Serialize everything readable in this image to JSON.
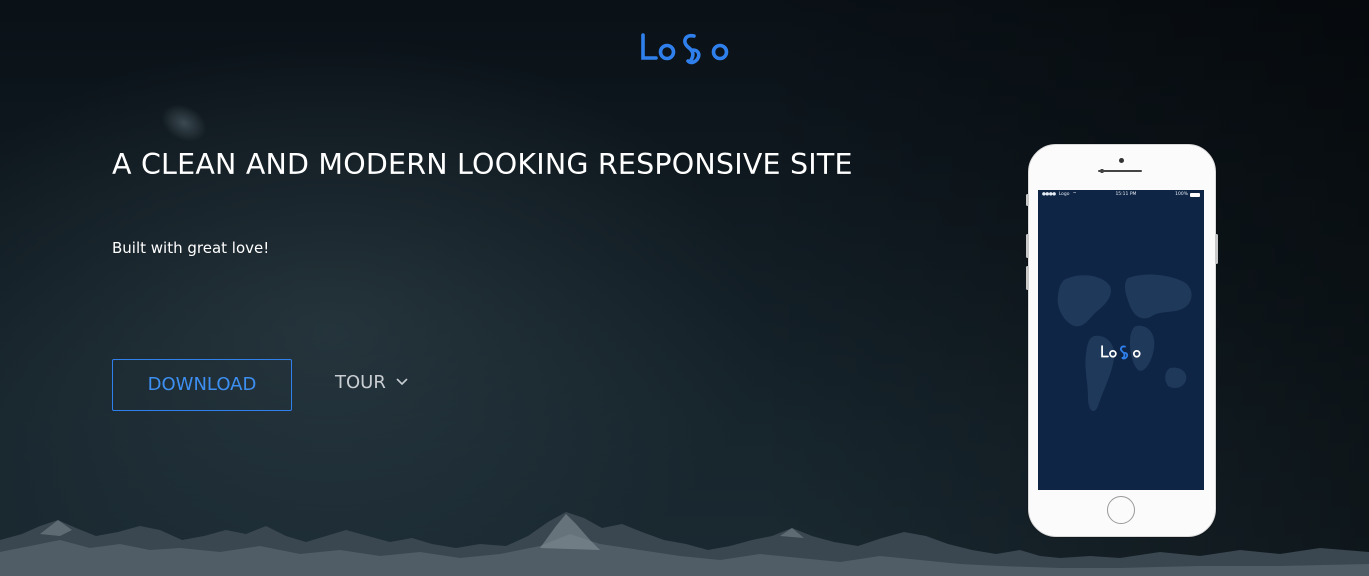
{
  "header": {
    "logo_text": "LoGo",
    "logo_color": "#2f80ed"
  },
  "hero": {
    "headline": "A CLEAN AND MODERN LOOKING RESPONSIVE SITE",
    "subtitle": "Built with great love!",
    "download_label": "DOWNLOAD",
    "tour_label": "TOUR",
    "tour_icon": "chevron-down-icon",
    "accent_color": "#2f80ed"
  },
  "phone": {
    "status_carrier": "Logo",
    "status_time": "15:11 PM",
    "status_battery": "100%",
    "screen_logo_text": "LoGo",
    "screen_background": "#0f2545"
  }
}
